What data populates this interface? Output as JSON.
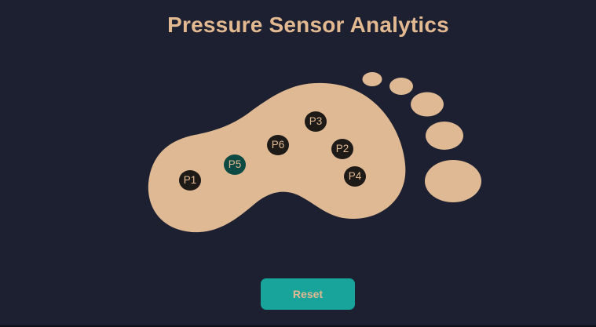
{
  "title": "Pressure Sensor Analytics",
  "colors": {
    "background": "#1c2031",
    "foot": "#dfb993",
    "sensor": "#1d1a17",
    "sensor_active": "#0d4a44",
    "accent": "#18a39b",
    "text": "#e2b991"
  },
  "sensors": [
    {
      "label": "P1",
      "active": false
    },
    {
      "label": "P2",
      "active": false
    },
    {
      "label": "P3",
      "active": false
    },
    {
      "label": "P4",
      "active": false
    },
    {
      "label": "P5",
      "active": true
    },
    {
      "label": "P6",
      "active": false
    }
  ],
  "reset_label": "Reset"
}
